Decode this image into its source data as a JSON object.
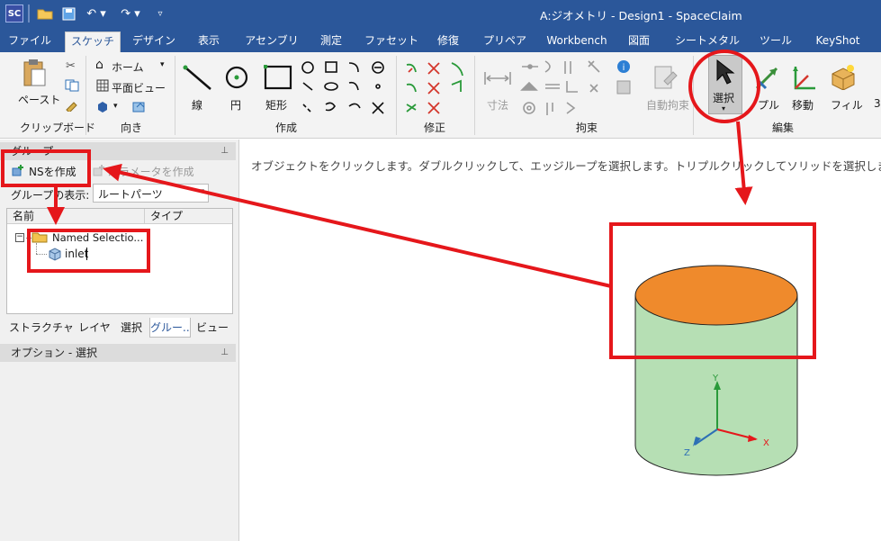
{
  "titlebar": {
    "title": "A:ジオメトリ - Design1 - SpaceClaim",
    "app_badge": "SC"
  },
  "tabs": [
    "ファイル",
    "スケッチ",
    "デザイン",
    "表示",
    "アセンブリ",
    "測定",
    "ファセット",
    "修復",
    "プリペア",
    "Workbench",
    "図面",
    "シートメタル",
    "ツール",
    "KeyShot"
  ],
  "active_tab": "スケッチ",
  "ribbon": {
    "clipboard": {
      "paste": "ペースト",
      "label": "クリップボード"
    },
    "orient": {
      "home": "ホーム",
      "plan_view": "平面ビュー",
      "label": "向き"
    },
    "create": {
      "line": "線",
      "circle": "円",
      "rectangle": "矩形",
      "label": "作成"
    },
    "modify": {
      "label": "修正"
    },
    "constraints": {
      "dimension": "寸法",
      "auto_constrain": "自動拘束",
      "label": "拘束"
    },
    "edit": {
      "select": "選択",
      "pull": "プル",
      "move": "移動",
      "fill": "フィル",
      "label": "編集",
      "next_number": "3"
    }
  },
  "left_panel": {
    "groups_title": "グループ",
    "create_ns": "NSを作成",
    "create_parameter": "パラメータを作成",
    "group_display_label": "グループの表示:",
    "group_display_value": "ルートパーツ",
    "col_name": "名前",
    "col_type": "タイプ",
    "tree": {
      "expander": "−",
      "folder": "Named Selectio...",
      "child": "inlet"
    },
    "bottom_tabs": [
      "ストラクチャ...",
      "レイヤ",
      "選択",
      "グルー...",
      "ビュー"
    ],
    "active_bottom_tab": "グルー...",
    "options_title": "オプション - 選択"
  },
  "workspace": {
    "hint": "オブジェクトをクリックします。ダブルクリックして、エッジループを選択します。トリプルクリックしてソリッドを選択します。",
    "triad": {
      "x": "X",
      "y": "Y",
      "z": "Z"
    }
  },
  "colors": {
    "ribbon_blue": "#2b579a",
    "annotation_red": "#e5171b",
    "cylinder_green": "#b6dfb4",
    "top_face_orange": "#ef8a2c"
  }
}
